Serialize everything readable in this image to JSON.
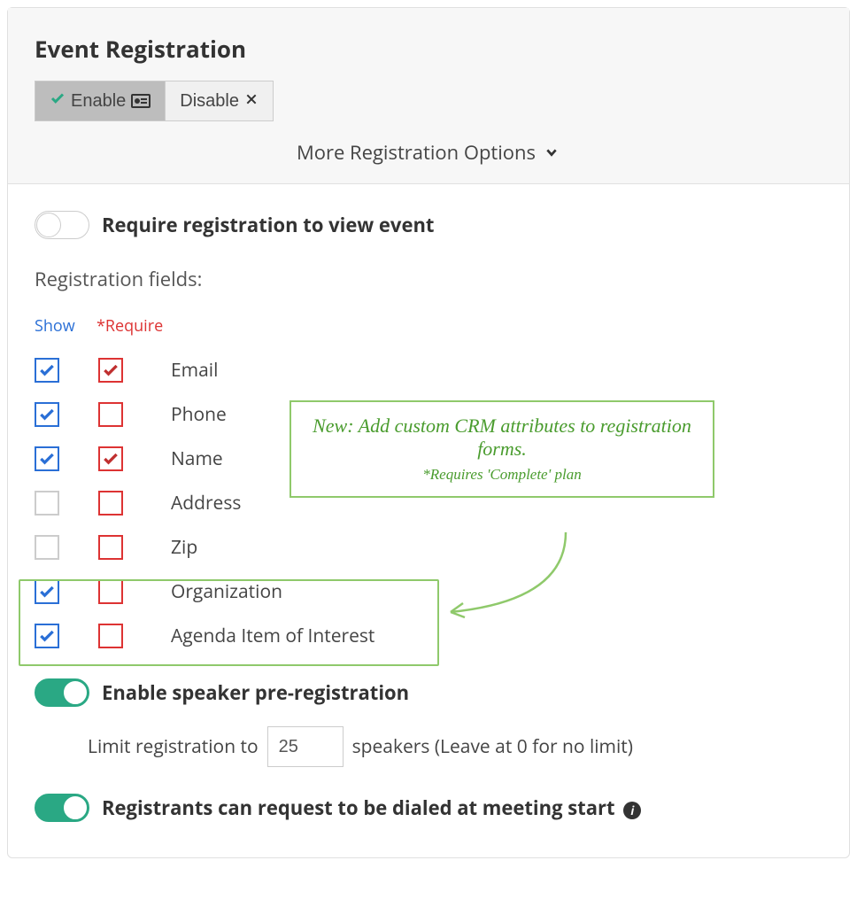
{
  "header": {
    "title": "Event Registration",
    "enable_label": "Enable",
    "disable_label": "Disable",
    "more_options": "More Registration Options"
  },
  "require_view": {
    "label": "Require registration to view event",
    "on": false
  },
  "fields_title": "Registration fields:",
  "columns": {
    "show": "Show",
    "require": "*Require"
  },
  "fields": [
    {
      "label": "Email",
      "show": true,
      "require": true
    },
    {
      "label": "Phone",
      "show": true,
      "require": false
    },
    {
      "label": "Name",
      "show": true,
      "require": true
    },
    {
      "label": "Address",
      "show": false,
      "require": false
    },
    {
      "label": "Zip",
      "show": false,
      "require": false
    },
    {
      "label": "Organization",
      "show": true,
      "require": false
    },
    {
      "label": "Agenda Item of Interest",
      "show": true,
      "require": false
    }
  ],
  "callout": {
    "main": "New: Add custom CRM attributes to registration forms.",
    "sub": "*Requires 'Complete' plan"
  },
  "prereg": {
    "label": "Enable speaker pre-registration",
    "on": true
  },
  "limit": {
    "prefix": "Limit registration to",
    "value": "25",
    "suffix": "speakers (Leave at 0 for no limit)"
  },
  "dialed": {
    "label": "Registrants can request to be dialed at meeting start",
    "on": true
  }
}
